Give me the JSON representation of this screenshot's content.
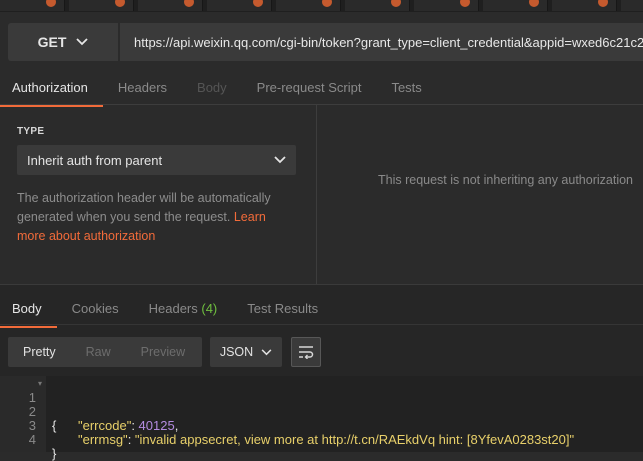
{
  "request": {
    "method": "GET",
    "url": "https://api.weixin.qq.com/cgi-bin/token?grant_type=client_credential&appid=wxed6c21c2fe"
  },
  "request_tabs": [
    {
      "label": "Authorization",
      "state": "active"
    },
    {
      "label": "Headers",
      "state": "normal"
    },
    {
      "label": "Body",
      "state": "disabled"
    },
    {
      "label": "Pre-request Script",
      "state": "normal"
    },
    {
      "label": "Tests",
      "state": "normal"
    }
  ],
  "auth": {
    "type_label": "TYPE",
    "type_value": "Inherit auth from parent",
    "description": "The authorization header will be automatically generated when you send the request.",
    "learn_more": "Learn more about authorization",
    "inherit_message": "This request is not inheriting any authorization"
  },
  "response_tabs": {
    "body": "Body",
    "cookies": "Cookies",
    "headers": "Headers",
    "headers_count": "(4)",
    "test_results": "Test Results"
  },
  "format": {
    "modes": [
      "Pretty",
      "Raw",
      "Preview"
    ],
    "active": "Pretty",
    "language": "JSON"
  },
  "code_lines": [
    {
      "n": "1",
      "text": "{"
    },
    {
      "n": "2",
      "key": "\"errcode\"",
      "sep": ": ",
      "value": "40125",
      "vtype": "num",
      "tail": ","
    },
    {
      "n": "3",
      "key": "\"errmsg\"",
      "sep": ": ",
      "value": "\"invalid appsecret, view more at http://t.cn/RAEkdVq hint: [8YfevA0283st20]\"",
      "vtype": "str",
      "tail": ""
    },
    {
      "n": "4",
      "text": "}"
    }
  ],
  "colors": {
    "accent": "#f26b3a",
    "headers_count": "#6fbf3f"
  }
}
